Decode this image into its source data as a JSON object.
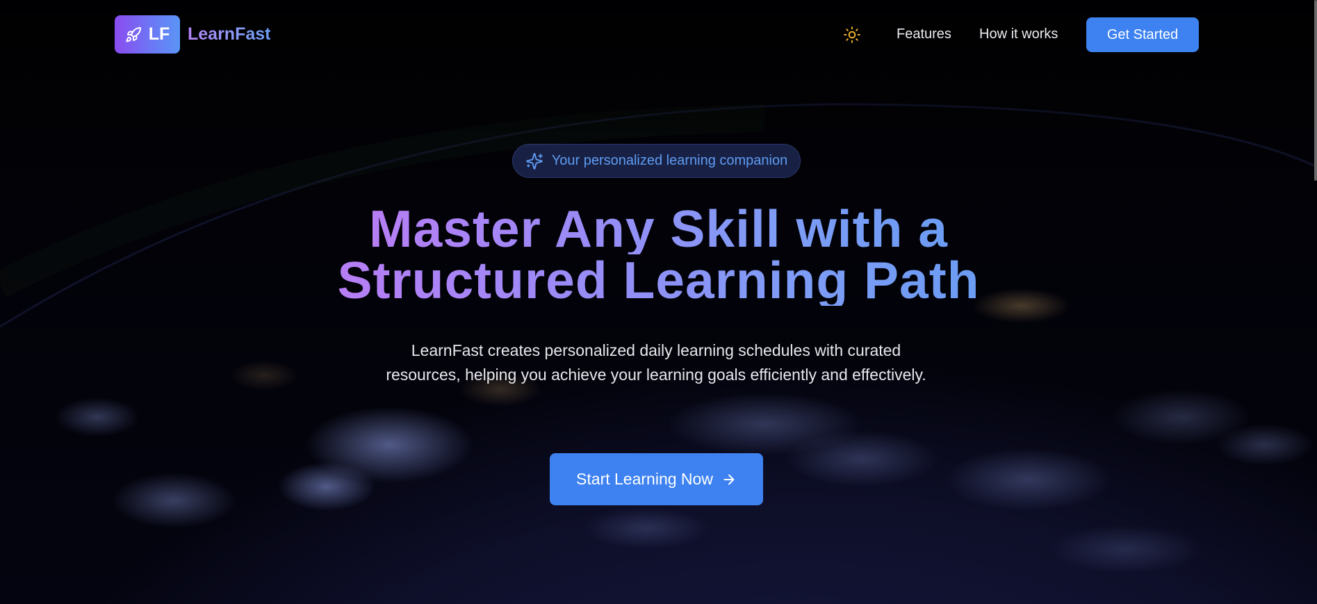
{
  "header": {
    "logo_initials": "LF",
    "logo_name": "LearnFast",
    "theme_toggle_icon": "sun-icon",
    "nav": [
      {
        "label": "Features"
      },
      {
        "label": "How it works"
      }
    ],
    "cta_label": "Get Started"
  },
  "hero": {
    "badge_icon": "sparkles-icon",
    "badge_text": "Your personalized learning companion",
    "headline_line1": "Master Any Skill with a",
    "headline_line2": "Structured Learning Path",
    "subtitle": "LearnFast creates personalized daily learning schedules with curated resources, helping you achieve your learning goals efficiently and effectively.",
    "cta_label": "Start Learning Now",
    "cta_icon": "arrow-right-icon"
  },
  "colors": {
    "primary_button": "#3d82f0",
    "gradient_start": "#b77ef5",
    "gradient_end": "#6c9cf3",
    "badge_text": "#5f9cf2",
    "sun_icon": "#f5b531"
  }
}
